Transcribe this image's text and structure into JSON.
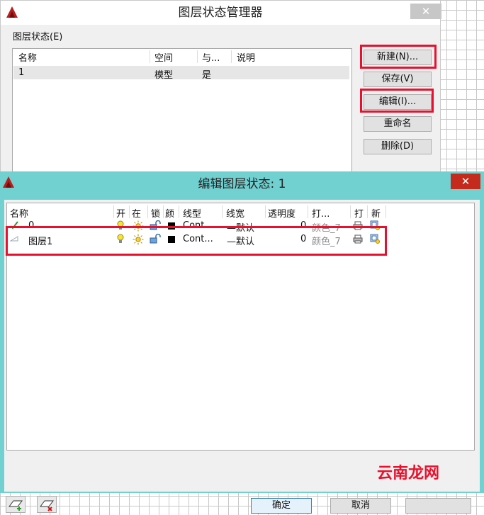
{
  "back_dialog": {
    "title": "图层状态管理器",
    "close_label": "✕",
    "group_label": "图层状态(E)",
    "columns": [
      "名称",
      "空间",
      "与...",
      "说明"
    ],
    "rows": [
      {
        "name": "1",
        "space": "模型",
        "same": "是",
        "desc": ""
      }
    ],
    "buttons": {
      "new": "新建(N)...",
      "save": "保存(V)",
      "edit": "编辑(I)...",
      "rename": "重命名",
      "delete": "删除(D)"
    }
  },
  "front_dialog": {
    "title": "编辑图层状态: 1",
    "close_label": "✕",
    "columns": [
      "名称",
      "开",
      "在",
      "锁",
      "颜",
      "线型",
      "线宽",
      "透明度",
      "打...",
      "打",
      "新"
    ],
    "rows": [
      {
        "name": "0",
        "linetype": "Cont...",
        "lineweight": "—默认",
        "transparency": "0",
        "plot_style": "颜色_7",
        "current": true
      },
      {
        "name": "图层1",
        "linetype": "Cont...",
        "lineweight": "—默认",
        "transparency": "0",
        "plot_style": "颜色_7",
        "current": false
      }
    ],
    "buttons": {
      "ok": "确定",
      "cancel": "取消"
    }
  },
  "watermark": "云南龙网",
  "colors": {
    "highlight_border": "#e8112d",
    "front_titlebar": "#71d0d0",
    "close_active": "#c42b1c"
  }
}
